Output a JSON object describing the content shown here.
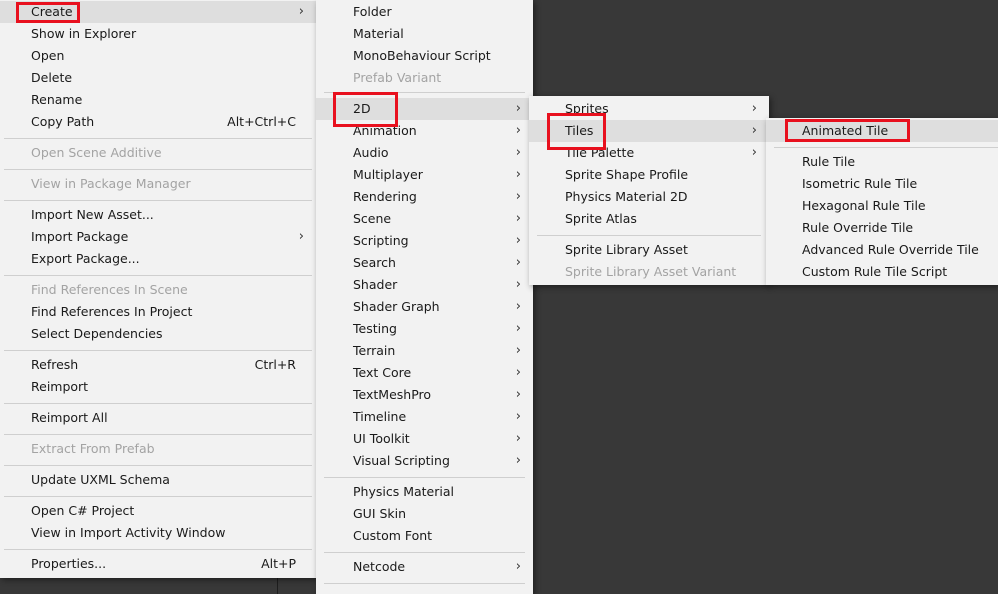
{
  "menu1": {
    "items": [
      {
        "label": "Create",
        "submenu": true
      },
      {
        "label": "Show in Explorer"
      },
      {
        "label": "Open"
      },
      {
        "label": "Delete"
      },
      {
        "label": "Rename"
      },
      {
        "label": "Copy Path",
        "shortcut": "Alt+Ctrl+C"
      },
      {
        "label": "Open Scene Additive",
        "disabled": true
      },
      {
        "label": "View in Package Manager",
        "disabled": true
      },
      {
        "label": "Import New Asset..."
      },
      {
        "label": "Import Package",
        "submenu": true
      },
      {
        "label": "Export Package..."
      },
      {
        "label": "Find References In Scene",
        "disabled": true
      },
      {
        "label": "Find References In Project"
      },
      {
        "label": "Select Dependencies"
      },
      {
        "label": "Refresh",
        "shortcut": "Ctrl+R"
      },
      {
        "label": "Reimport"
      },
      {
        "label": "Reimport All"
      },
      {
        "label": "Extract From Prefab",
        "disabled": true
      },
      {
        "label": "Update UXML Schema"
      },
      {
        "label": "Open C# Project"
      },
      {
        "label": "View in Import Activity Window"
      },
      {
        "label": "Properties...",
        "shortcut": "Alt+P"
      }
    ]
  },
  "menu2": {
    "items": [
      {
        "label": "Folder"
      },
      {
        "label": "Material"
      },
      {
        "label": "MonoBehaviour Script"
      },
      {
        "label": "Prefab Variant",
        "disabled": true
      },
      {
        "label": "2D",
        "submenu": true
      },
      {
        "label": "Animation",
        "submenu": true
      },
      {
        "label": "Audio",
        "submenu": true
      },
      {
        "label": "Multiplayer",
        "submenu": true
      },
      {
        "label": "Rendering",
        "submenu": true
      },
      {
        "label": "Scene",
        "submenu": true
      },
      {
        "label": "Scripting",
        "submenu": true
      },
      {
        "label": "Search",
        "submenu": true
      },
      {
        "label": "Shader",
        "submenu": true
      },
      {
        "label": "Shader Graph",
        "submenu": true
      },
      {
        "label": "Testing",
        "submenu": true
      },
      {
        "label": "Terrain",
        "submenu": true
      },
      {
        "label": "Text Core",
        "submenu": true
      },
      {
        "label": "TextMeshPro",
        "submenu": true
      },
      {
        "label": "Timeline",
        "submenu": true
      },
      {
        "label": "UI Toolkit",
        "submenu": true
      },
      {
        "label": "Visual Scripting",
        "submenu": true
      },
      {
        "label": "Physics Material"
      },
      {
        "label": "GUI Skin"
      },
      {
        "label": "Custom Font"
      },
      {
        "label": "Netcode",
        "submenu": true
      }
    ]
  },
  "menu3": {
    "items": [
      {
        "label": "Sprites",
        "submenu": true
      },
      {
        "label": "Tiles",
        "submenu": true
      },
      {
        "label": "Tile Palette",
        "submenu": true
      },
      {
        "label": "Sprite Shape Profile"
      },
      {
        "label": "Physics Material 2D"
      },
      {
        "label": "Sprite Atlas"
      },
      {
        "label": "Sprite Library Asset"
      },
      {
        "label": "Sprite Library Asset Variant",
        "disabled": true
      }
    ]
  },
  "menu4": {
    "items": [
      {
        "label": "Animated Tile"
      },
      {
        "label": "Rule Tile"
      },
      {
        "label": "Isometric Rule Tile"
      },
      {
        "label": "Hexagonal Rule Tile"
      },
      {
        "label": "Rule Override Tile"
      },
      {
        "label": "Advanced Rule Override Tile"
      },
      {
        "label": "Custom Rule Tile Script"
      }
    ]
  },
  "arrow_glyph": "›",
  "highlight_color": "#e8101e"
}
